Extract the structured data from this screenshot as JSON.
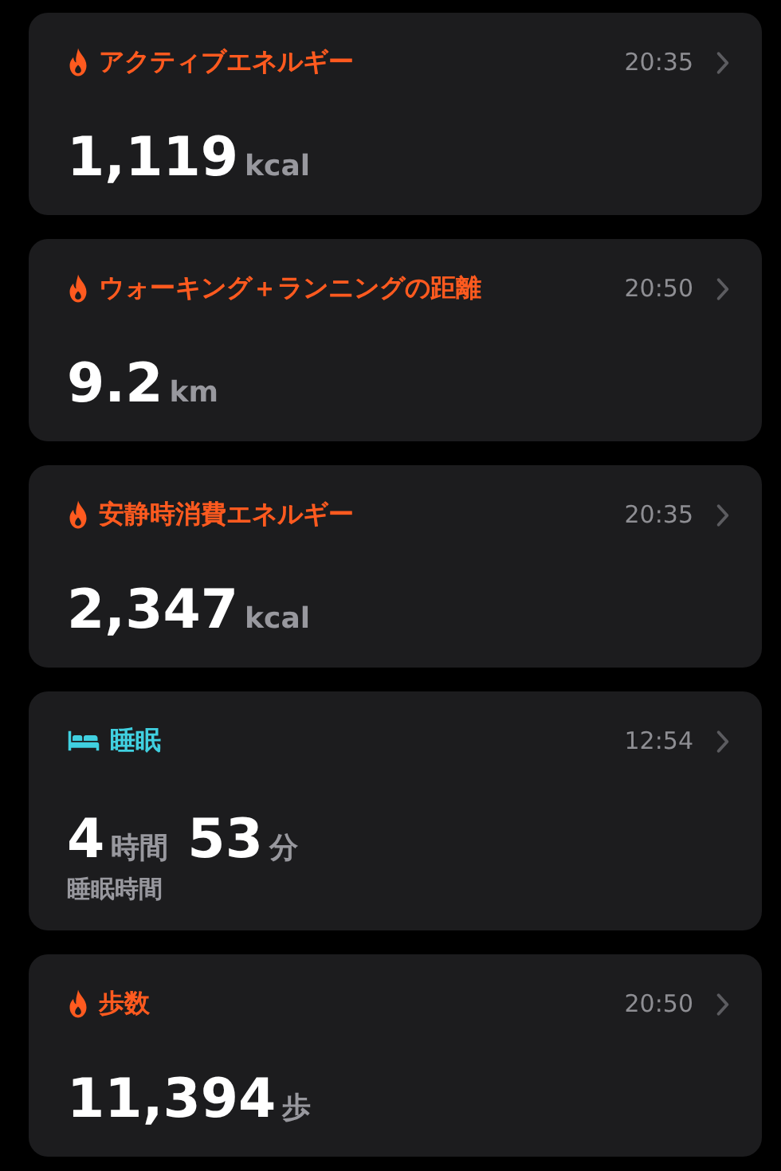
{
  "cards": [
    {
      "kind": "fire",
      "color": "#ff5a1f",
      "title": "アクティブエネルギー",
      "time": "20:35",
      "values": [
        {
          "number": "1,119",
          "unit": "kcal"
        }
      ]
    },
    {
      "kind": "fire",
      "color": "#ff5a1f",
      "title": "ウォーキング＋ランニングの距離",
      "time": "20:50",
      "values": [
        {
          "number": "9.2",
          "unit": "km"
        }
      ]
    },
    {
      "kind": "fire",
      "color": "#ff5a1f",
      "title": "安静時消費エネルギー",
      "time": "20:35",
      "values": [
        {
          "number": "2,347",
          "unit": "kcal"
        }
      ]
    },
    {
      "kind": "sleep",
      "color": "#40d0e0",
      "title": "睡眠",
      "time": "12:54",
      "values": [
        {
          "number": "4",
          "unit": "時間"
        },
        {
          "number": "53",
          "unit": "分"
        }
      ],
      "subtitle": "睡眠時間"
    },
    {
      "kind": "fire",
      "color": "#ff5a1f",
      "title": "歩数",
      "time": "20:50",
      "values": [
        {
          "number": "11,394",
          "unit": "歩"
        }
      ]
    }
  ]
}
